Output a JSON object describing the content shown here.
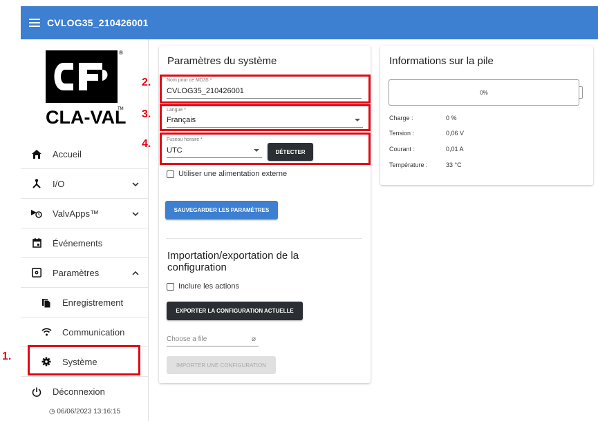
{
  "header": {
    "title": "CVLOG35_210426001"
  },
  "logo": {
    "brand_text": "CLA-VAL",
    "tm": "TM",
    "reg": "®"
  },
  "sidebar": {
    "items": [
      {
        "label": "Accueil"
      },
      {
        "label": "I/O"
      },
      {
        "label": "ValvApps™"
      },
      {
        "label": "Événements"
      },
      {
        "label": "Paramètres"
      },
      {
        "label": "Enregistrement"
      },
      {
        "label": "Communication"
      },
      {
        "label": "Système"
      },
      {
        "label": "Déconnexion"
      }
    ],
    "timestamp": "06/06/2023 13:16:15"
  },
  "annotations": {
    "n1": "1.",
    "n2": "2.",
    "n3": "3.",
    "n4": "4."
  },
  "system": {
    "title": "Paramètres du système",
    "name_label": "Nom pour ce MD35 *",
    "name_value": "CVLOG35_210426001",
    "language_label": "Langue *",
    "language_value": "Français",
    "timezone_label": "Fuseau horaire *",
    "timezone_value": "UTC",
    "detect_label": "DÉTECTER",
    "external_power_label": "Utiliser une alimentation externe",
    "save_label": "SAUVEGARDER LES PARAMÈTRES"
  },
  "config": {
    "title_line1": "Importation/exportation de la",
    "title_line2": "configuration",
    "include_actions_label": "Inclure les actions",
    "export_label": "EXPORTER LA CONFIGURATION ACTUELLE",
    "file_placeholder": "Choose a file",
    "import_label": "IMPORTER UNE CONFIGURATION"
  },
  "battery": {
    "title": "Informations sur la pile",
    "percent_text": "0%",
    "rows": [
      {
        "label": "Charge :",
        "value": "0 %"
      },
      {
        "label": "Tension :",
        "value": "0,06 V"
      },
      {
        "label": "Courant :",
        "value": "0,01 A"
      },
      {
        "label": "Température :",
        "value": "33 °C"
      }
    ]
  },
  "colors": {
    "primary": "#3d7fd1",
    "annotation": "#e30613",
    "dark_button": "#2b2f33"
  }
}
